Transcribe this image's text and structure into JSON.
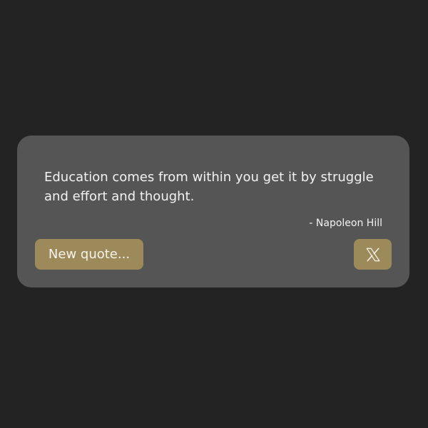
{
  "quote": {
    "text": "Education comes from within you get it by struggle and effort and thought.",
    "author": "- Napoleon Hill"
  },
  "actions": {
    "new_quote_label": "New quote...",
    "tweet_icon": "x-logo-icon"
  },
  "colors": {
    "page_background": "#232323",
    "card_background": "#555555",
    "button_accent": "#9c8a5a",
    "text": "#f2f2f2"
  }
}
